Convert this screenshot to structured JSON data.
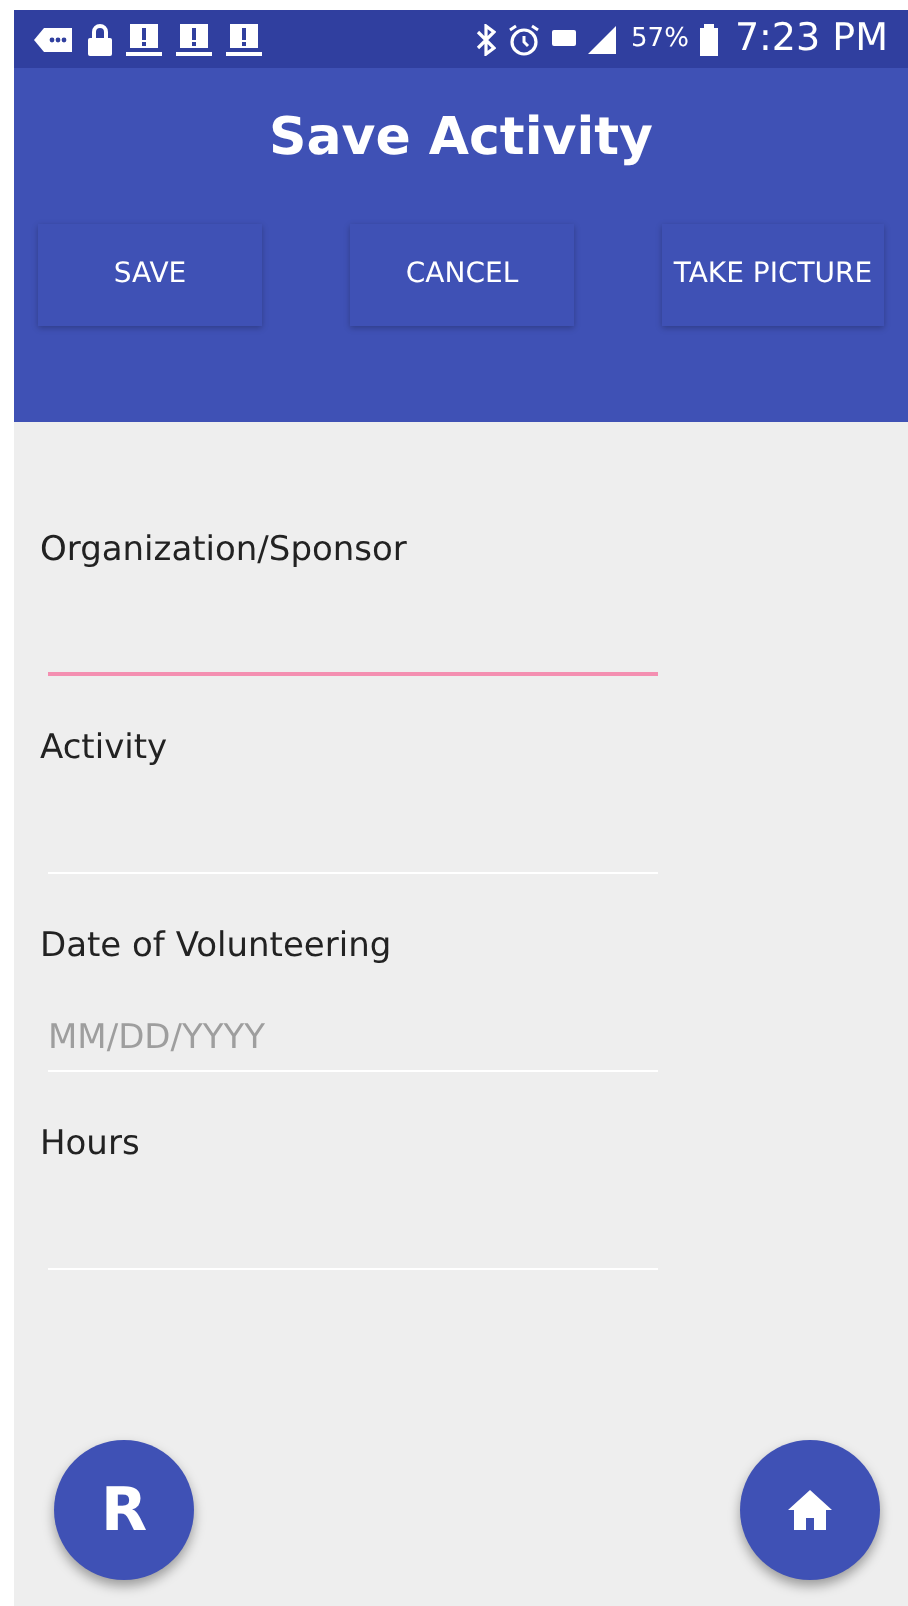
{
  "status_bar": {
    "battery": "57%",
    "time": "7:23 PM"
  },
  "title": "Save Activity",
  "actions": [
    "SAVE",
    "CANCEL",
    "TAKE PICTURE"
  ],
  "fields": [
    {
      "label": "Organization/Sponsor",
      "focused": true
    },
    {
      "label": "Activity",
      "focused": false
    },
    {
      "label": "Date of Volunteering",
      "placeholder": "MM/DD/YYYY",
      "focused": false
    },
    {
      "label": "Hours",
      "focused": false
    }
  ],
  "fab_left": {
    "letter": "R"
  }
}
